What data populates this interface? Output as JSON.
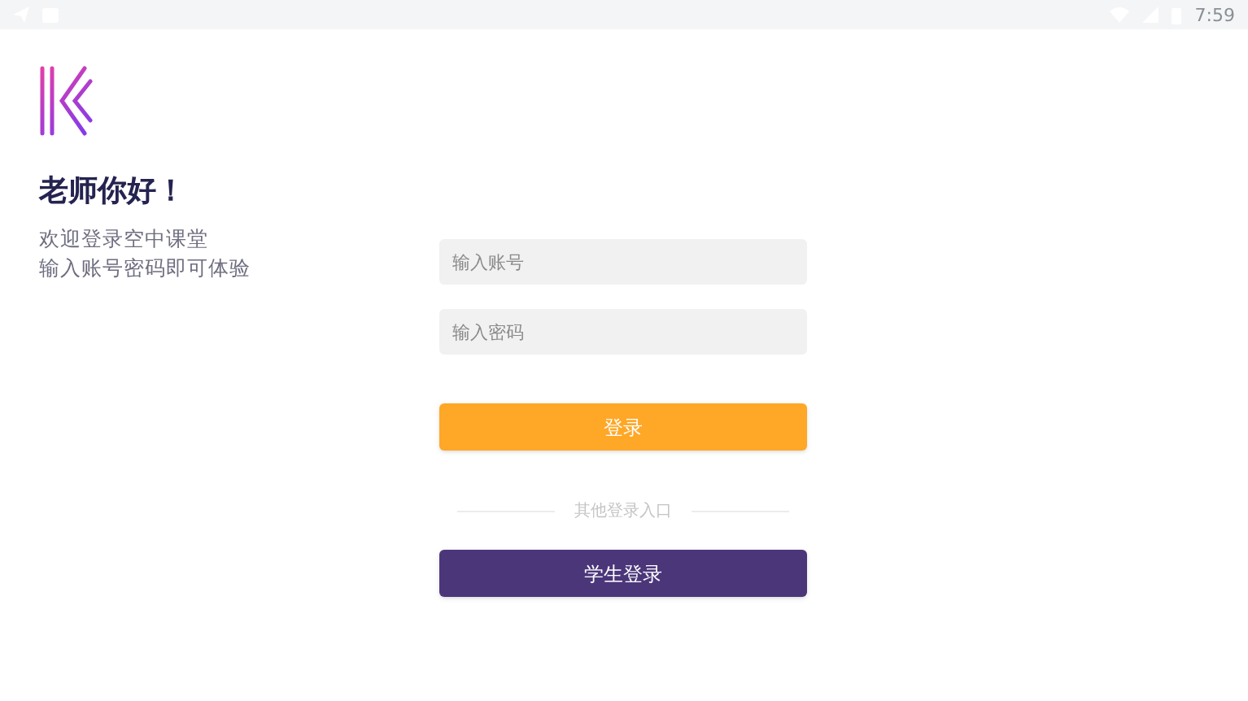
{
  "status_bar": {
    "time": "7:59"
  },
  "greeting": {
    "title": "老师你好！",
    "lines": [
      "欢迎登录空中课堂",
      "输入账号密码即可体验"
    ]
  },
  "form": {
    "account": {
      "placeholder": "输入账号"
    },
    "password": {
      "placeholder": "输入密码"
    },
    "login_button": "登录",
    "divider": "其他登录入口",
    "student_button": "学生登录"
  }
}
